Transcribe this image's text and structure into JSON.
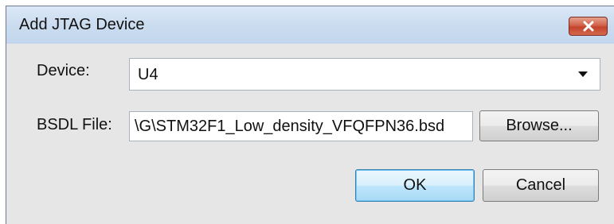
{
  "dialog": {
    "title": "Add JTAG Device",
    "close_glyph": "✕"
  },
  "device": {
    "label": "Device:",
    "value": "U4"
  },
  "bsdl": {
    "label": "BSDL File:",
    "value": "\\G\\STM32F1_Low_density_VFQFPN36.bsd",
    "browse_label": "Browse..."
  },
  "buttons": {
    "ok_label": "OK",
    "cancel_label": "Cancel"
  },
  "icons": {
    "close": "close-icon",
    "dropdown": "chevron-down-icon"
  },
  "colors": {
    "close_button": "#c3432b",
    "default_button_border": "#3c7fb1"
  }
}
